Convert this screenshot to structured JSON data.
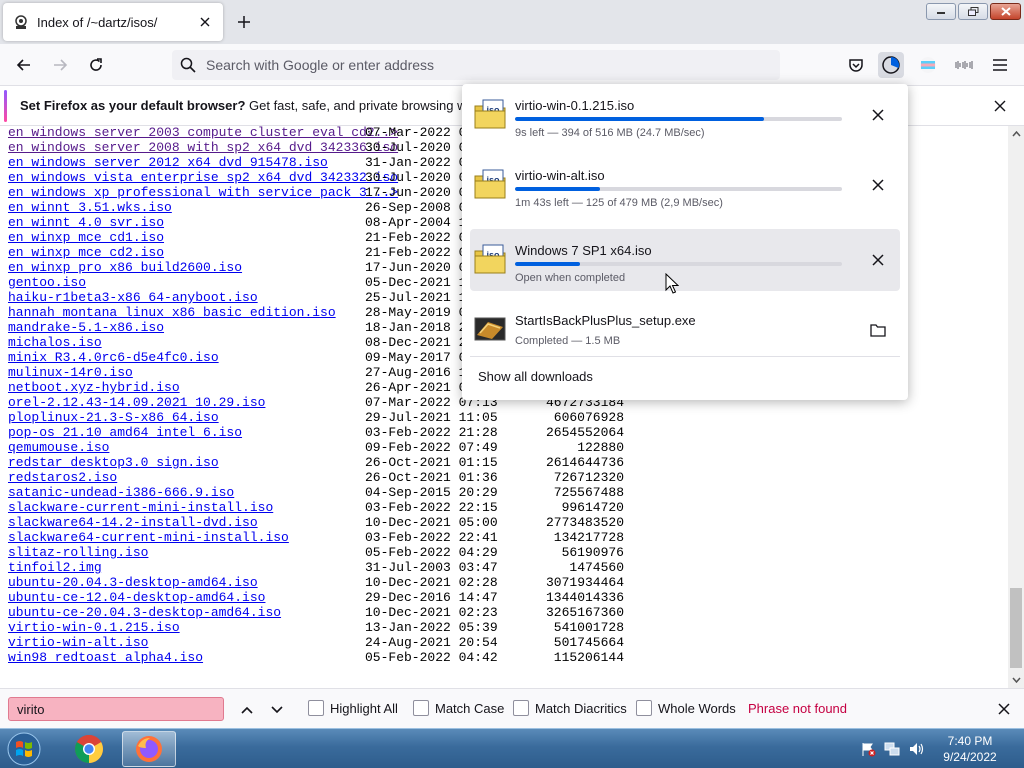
{
  "tab": {
    "title": "Index of /~dartz/isos/"
  },
  "urlbar": {
    "placeholder": "Search with Google or enter address"
  },
  "notification": {
    "title": "Set Firefox as your default browser?",
    "message": " Get fast, safe, and private browsing whenever"
  },
  "listing": {
    "rows": [
      {
        "name": "en_windows_server_2003_compute_cluster_eval_cd2..>",
        "date": "07-Mar-2022 03",
        "size": ""
      },
      {
        "name": "en_windows_server_2008_with_sp2_x64_dvd_342336.iso",
        "date": "30-Jul-2020 03",
        "size": ""
      },
      {
        "name": "en_windows_server_2012_x64_dvd_915478.iso",
        "date": "31-Jan-2022 06",
        "size": ""
      },
      {
        "name": "en_windows_vista_enterprise_sp2_x64_dvd_342332.iso",
        "date": "30-Jul-2020 03",
        "size": ""
      },
      {
        "name": "en_windows_xp_professional_with_service_pack_3_..>",
        "date": "17-Jun-2020 06",
        "size": ""
      },
      {
        "name": "en_winnt_3.51.wks.iso",
        "date": "26-Sep-2008 00",
        "size": ""
      },
      {
        "name": "en_winnt_4.0_svr.iso",
        "date": "08-Apr-2004 12",
        "size": ""
      },
      {
        "name": "en_winxp_mce_cd1.iso",
        "date": "21-Feb-2022 08",
        "size": ""
      },
      {
        "name": "en_winxp_mce_cd2.iso",
        "date": "21-Feb-2022 08",
        "size": ""
      },
      {
        "name": "en_winxp_pro_x86_build2600.iso",
        "date": "17-Jun-2020 06",
        "size": ""
      },
      {
        "name": "gentoo.iso",
        "date": "05-Dec-2021 19",
        "size": ""
      },
      {
        "name": "haiku-r1beta3-x86_64-anyboot.iso",
        "date": "25-Jul-2021 12",
        "size": ""
      },
      {
        "name": "hannah_montana_linux_x86_basic_edition.iso",
        "date": "28-May-2019 06",
        "size": ""
      },
      {
        "name": "mandrake-5.1-x86.iso",
        "date": "18-Jan-2018 21",
        "size": ""
      },
      {
        "name": "michalos.iso",
        "date": "08-Dec-2021 22",
        "size": ""
      },
      {
        "name": "minix_R3.4.0rc6-d5e4fc0.iso",
        "date": "09-May-2017 06",
        "size": ""
      },
      {
        "name": "mulinux-14r0.iso",
        "date": "27-Aug-2016 11",
        "size": ""
      },
      {
        "name": "netboot.xyz-hybrid.iso",
        "date": "26-Apr-2021 01",
        "size": ""
      },
      {
        "name": "orel-2.12.43-14.09.2021_10.29.iso",
        "date": "07-Mar-2022 07:13",
        "size": "4672733184"
      },
      {
        "name": "ploplinux-21.3-S-x86_64.iso",
        "date": "29-Jul-2021 11:05",
        "size": "606076928"
      },
      {
        "name": "pop-os_21.10_amd64_intel_6.iso",
        "date": "03-Feb-2022 21:28",
        "size": "2654552064"
      },
      {
        "name": "qemumouse.iso",
        "date": "09-Feb-2022 07:49",
        "size": "122880"
      },
      {
        "name": "redstar_desktop3.0_sign.iso",
        "date": "26-Oct-2021 01:15",
        "size": "2614644736"
      },
      {
        "name": "redstaros2.iso",
        "date": "26-Oct-2021 01:36",
        "size": "726712320"
      },
      {
        "name": "satanic-undead-i386-666.9.iso",
        "date": "04-Sep-2015 20:29",
        "size": "725567488"
      },
      {
        "name": "slackware-current-mini-install.iso",
        "date": "03-Feb-2022 22:15",
        "size": "99614720"
      },
      {
        "name": "slackware64-14.2-install-dvd.iso",
        "date": "10-Dec-2021 05:00",
        "size": "2773483520"
      },
      {
        "name": "slackware64-current-mini-install.iso",
        "date": "03-Feb-2022 22:41",
        "size": "134217728"
      },
      {
        "name": "slitaz-rolling.iso",
        "date": "05-Feb-2022 04:29",
        "size": "56190976"
      },
      {
        "name": "tinfoil2.img",
        "date": "31-Jul-2003 03:47",
        "size": "1474560"
      },
      {
        "name": "ubuntu-20.04.3-desktop-amd64.iso",
        "date": "10-Dec-2021 02:28",
        "size": "3071934464"
      },
      {
        "name": "ubuntu-ce-12.04-desktop-amd64.iso",
        "date": "29-Dec-2016 14:47",
        "size": "1344014336"
      },
      {
        "name": "ubuntu-ce-20.04.3-desktop-amd64.iso",
        "date": "10-Dec-2021 02:23",
        "size": "3265167360"
      },
      {
        "name": "virtio-win-0.1.215.iso",
        "date": "13-Jan-2022 05:39",
        "size": "541001728"
      },
      {
        "name": "virtio-win-alt.iso",
        "date": "24-Aug-2021 20:54",
        "size": "501745664"
      },
      {
        "name": "win98_redtoast_alpha4.iso",
        "date": "05-Feb-2022 04:42",
        "size": "115206144"
      }
    ]
  },
  "downloads": {
    "items": [
      {
        "name": "virtio-win-0.1.215.iso",
        "status": "9s left — 394 of 516 MB (24.7 MB/sec)",
        "progress": 0.76,
        "state": "downloading"
      },
      {
        "name": "virtio-win-alt.iso",
        "status": "1m 43s left — 125 of 479 MB (2,9 MB/sec)",
        "progress": 0.26,
        "state": "downloading"
      },
      {
        "name": "Windows 7 SP1 x64.iso",
        "status": "Open when completed",
        "progress": 0.2,
        "state": "downloading"
      },
      {
        "name": "StartIsBackPlusPlus_setup.exe",
        "status": "Completed — 1.5 MB",
        "state": "completed"
      }
    ],
    "show_all_label": "Show all downloads"
  },
  "findbar": {
    "query": "virito",
    "highlight_all": "Highlight All",
    "match_case": "Match Case",
    "match_diacritics": "Match Diacritics",
    "whole_words": "Whole Words",
    "status": "Phrase not found"
  },
  "taskbar": {
    "time": "7:40 PM",
    "date": "9/24/2022"
  },
  "colors": {
    "accent": "#0060df",
    "link": "#0000ee",
    "visited": "#551a8b",
    "not_found": "#c50042",
    "find_bg": "#f7b3c1"
  }
}
